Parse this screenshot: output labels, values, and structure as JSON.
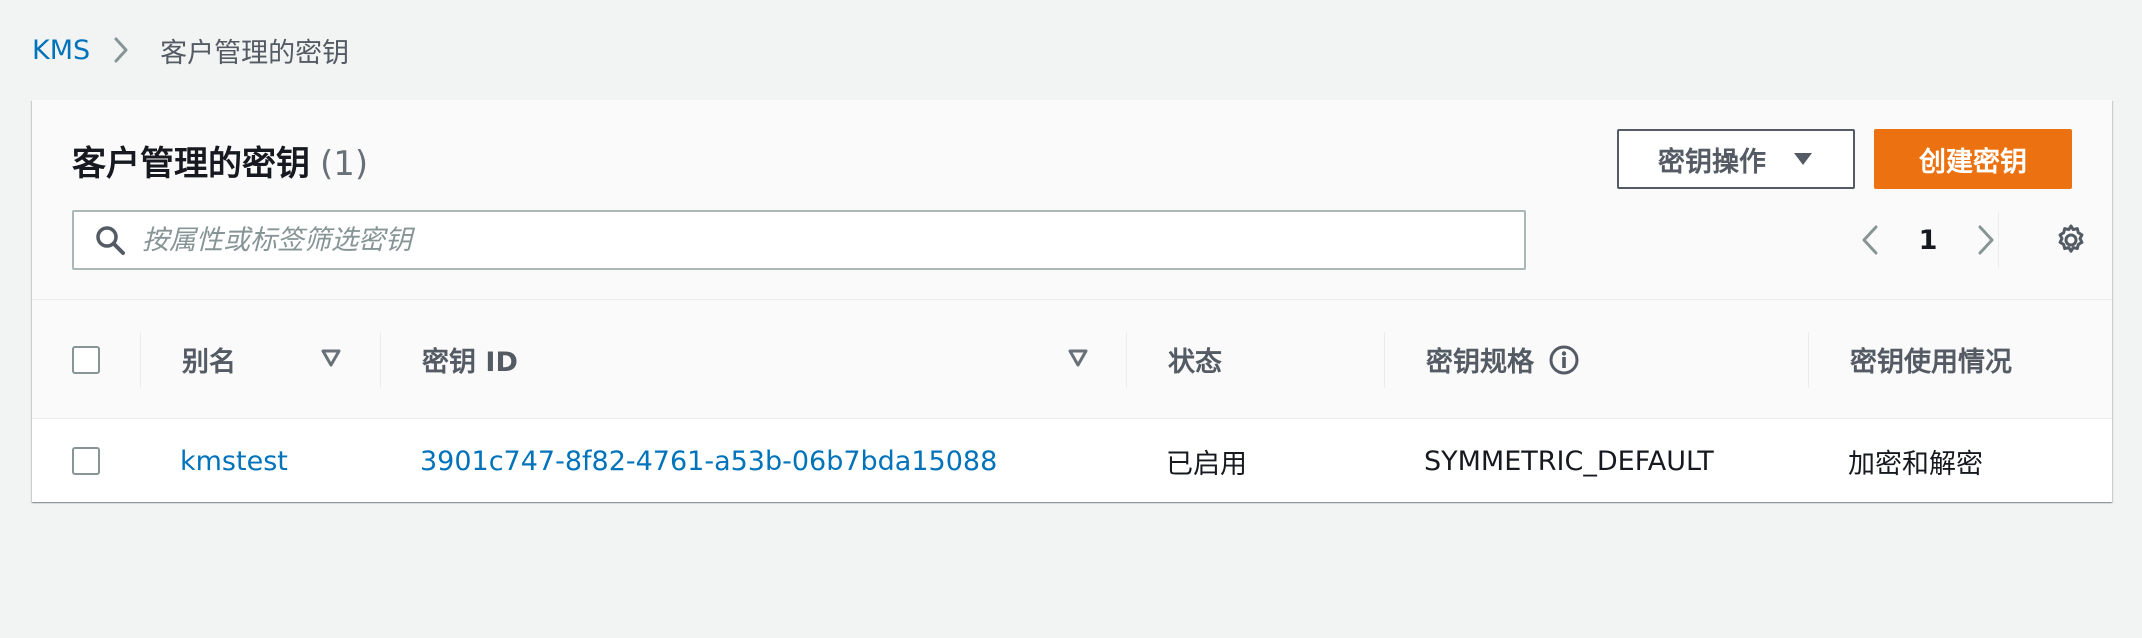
{
  "breadcrumb": {
    "root": "KMS",
    "current": "客户管理的密钥"
  },
  "panel": {
    "title": "客户管理的密钥",
    "count": "(1)",
    "actions_button": "密钥操作",
    "create_button": "创建密钥",
    "search_placeholder": "按属性或标签筛选密钥",
    "page_number": "1"
  },
  "table": {
    "columns": {
      "alias": "别名",
      "key_id": "密钥 ID",
      "status": "状态",
      "key_spec": "密钥规格",
      "key_usage": "密钥使用情况"
    },
    "rows": [
      {
        "alias": "kmstest",
        "key_id": "3901c747-8f82-4761-a53b-06b7bda15088",
        "status": "已启用",
        "key_spec": "SYMMETRIC_DEFAULT",
        "key_usage": "加密和解密"
      }
    ]
  },
  "colors": {
    "link": "#0073bb",
    "primary_button": "#ec7211",
    "background": "#f2f3f3"
  },
  "icons": [
    "chevron-right-icon",
    "caret-down-icon",
    "search-icon",
    "chevron-left-icon",
    "gear-icon",
    "sort-icon",
    "info-icon",
    "checkbox"
  ]
}
